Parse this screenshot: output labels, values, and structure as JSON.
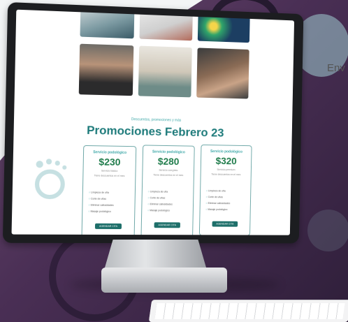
{
  "side_text": "Env",
  "screen": {
    "tagline": "Descuentos, promociones y más",
    "title": "Promociones Febrero 23",
    "cards": [
      {
        "title": "Servicio podológico",
        "price": "$230",
        "sub": "Servicio básico",
        "sub2": "Tiene descuentos en el mes",
        "items": [
          "Limpieza de uña",
          "Corte de uñas",
          "Eliminar callosidades",
          "Masaje podológico"
        ],
        "button": "AGENDAR CITA"
      },
      {
        "title": "Servicio podológico",
        "price": "$280",
        "sub": "Servicio completo",
        "sub2": "Tiene descuentos en el mes",
        "items": [
          "Limpieza de uña",
          "Corte de uñas",
          "Eliminar callosidades",
          "Masaje podológico"
        ],
        "button": "AGENDAR CITA"
      },
      {
        "title": "Servicio podológico",
        "price": "$320",
        "sub": "Servicio premium",
        "sub2": "Tiene descuentos en el mes",
        "items": [
          "Limpieza de uña",
          "Corte de uñas",
          "Eliminar callosidades",
          "Masaje podológico"
        ],
        "button": "AGENDAR CITA"
      }
    ]
  }
}
